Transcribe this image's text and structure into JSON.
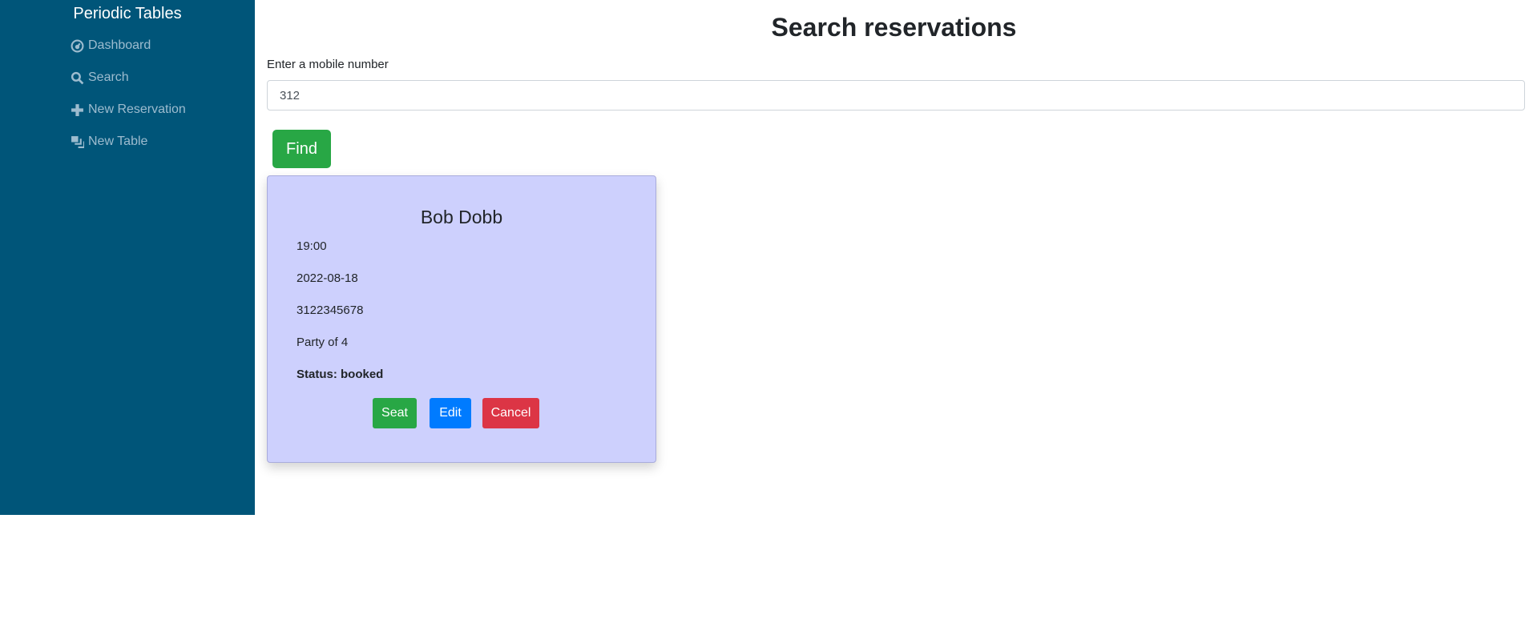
{
  "sidebar": {
    "brand": "Periodic Tables",
    "items": [
      {
        "label": "Dashboard",
        "icon": "dashboard-icon"
      },
      {
        "label": "Search",
        "icon": "search-icon"
      },
      {
        "label": "New Reservation",
        "icon": "plus-icon"
      },
      {
        "label": "New Table",
        "icon": "layers-icon"
      }
    ]
  },
  "main": {
    "title": "Search reservations",
    "label": "Enter a mobile number",
    "input_value": "312",
    "find_label": "Find"
  },
  "reservation": {
    "name": "Bob Dobb",
    "time": "19:00",
    "date": "2022-08-18",
    "mobile": "3122345678",
    "party": "Party of 4",
    "status": "Status: booked",
    "seat_label": "Seat",
    "edit_label": "Edit",
    "cancel_label": "Cancel"
  },
  "colors": {
    "sidebar": "#005579",
    "success": "#28a745",
    "primary": "#007bff",
    "danger": "#dc3545",
    "card": "#cdd0fd"
  }
}
